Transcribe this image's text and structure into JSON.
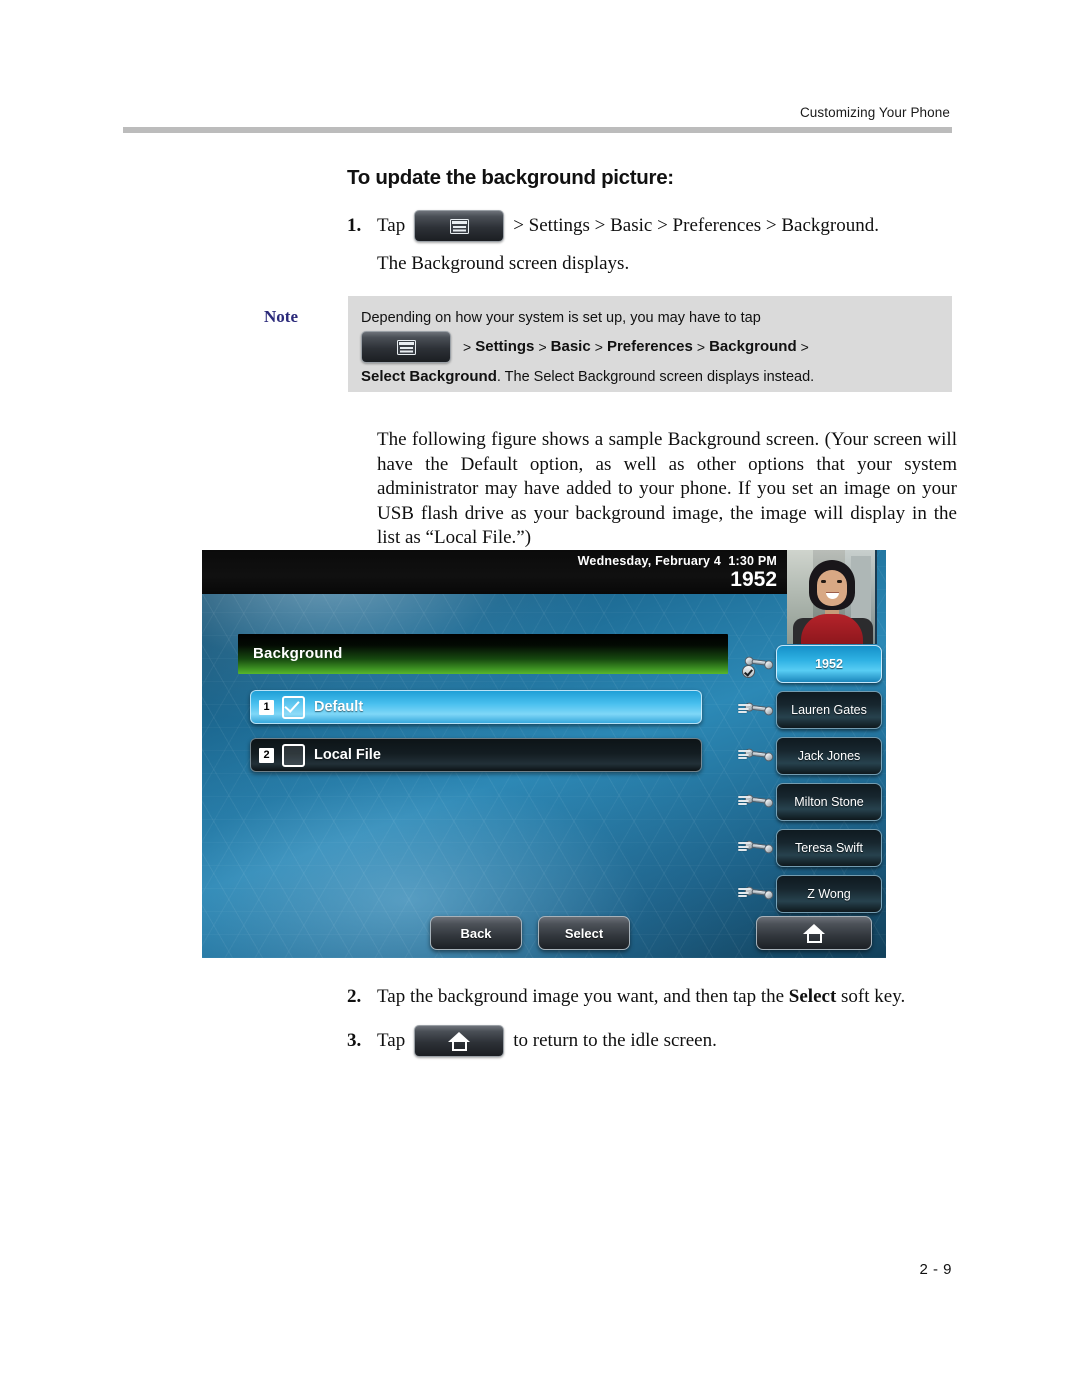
{
  "header": {
    "running_title": "Customizing Your Phone"
  },
  "heading": "To update the background picture:",
  "steps": {
    "step1": {
      "number": "1.",
      "tap_label": "Tap",
      "icon": "menu-key-icon",
      "path": "> Settings > Basic > Preferences > Background.",
      "result": "The Background screen displays."
    },
    "step2": {
      "number": "2.",
      "text_before": "Tap the background image you want, and then tap the ",
      "bold": "Select",
      "text_after": " soft key."
    },
    "step3": {
      "number": "3.",
      "tap_label": "Tap",
      "icon": "home-key-icon",
      "text_after": "to return to the idle screen."
    }
  },
  "note": {
    "label": "Note",
    "line1": "Depending on how your system is set up, you may have to tap",
    "icon": "menu-key-icon",
    "path_prefix": ">",
    "path_items": [
      "Settings",
      "Basic",
      "Preferences",
      "Background"
    ],
    "path_suffix": ">",
    "line3_bold": "Select Background",
    "line3_rest": ". The Select Background screen displays instead."
  },
  "figure_intro": "The following figure shows a sample Background screen. (Your screen will have the Default option, as well as other options that your system administrator may have added to your phone. If you set an image on your USB flash drive as your background image, the image will display in the list as “Local File.”)",
  "phone": {
    "status": {
      "datetime": "Wednesday, February 4  1:30 PM",
      "extension": "1952"
    },
    "avatar": "user-photo",
    "screen_title": "Background",
    "list": [
      {
        "index": "1",
        "label": "Default",
        "checked": true,
        "selected": true
      },
      {
        "index": "2",
        "label": "Local File",
        "checked": false,
        "selected": false
      }
    ],
    "line_keys": [
      {
        "label": "1952",
        "active": true,
        "icon": "handset-registered-icon"
      },
      {
        "label": "Lauren Gates",
        "active": false,
        "icon": "handset-icon"
      },
      {
        "label": "Jack Jones",
        "active": false,
        "icon": "handset-icon"
      },
      {
        "label": "Milton Stone",
        "active": false,
        "icon": "handset-icon"
      },
      {
        "label": "Teresa Swift",
        "active": false,
        "icon": "handset-icon"
      },
      {
        "label": "Z Wong",
        "active": false,
        "icon": "handset-icon"
      }
    ],
    "softkeys": [
      {
        "label": "Back"
      },
      {
        "label": "Select"
      }
    ],
    "home_key": "home-icon"
  },
  "footer": {
    "page_number": "2 - 9"
  },
  "colors": {
    "note_background": "#dadada",
    "note_label": "#2b2a7a",
    "rule": "#bcbcbc",
    "title_bar_green": "#58b72c",
    "selected_row_blue": "#49c0ef"
  }
}
